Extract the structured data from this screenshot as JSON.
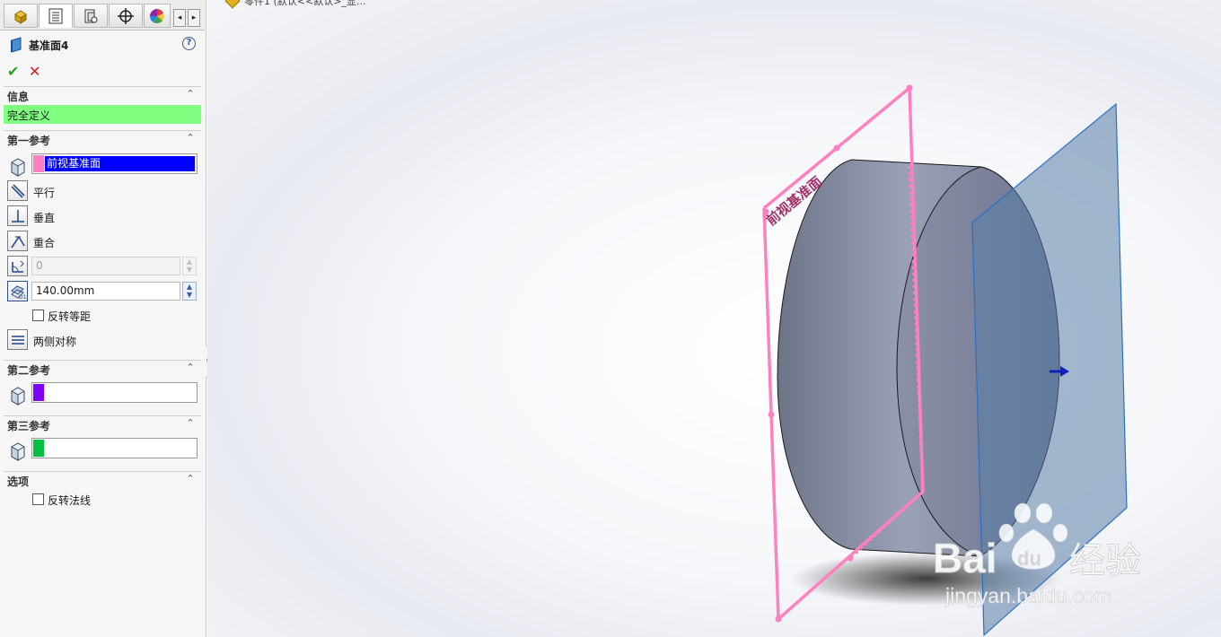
{
  "feature": {
    "title": "基准面4",
    "help": "?",
    "ok": "✔",
    "cancel": "✕"
  },
  "tabs": [
    {
      "name": "featuremanager",
      "icon": "part-feature-icon"
    },
    {
      "name": "propertymanager",
      "icon": "property-list-icon",
      "active": true
    },
    {
      "name": "configurationmanager",
      "icon": "config-icon"
    },
    {
      "name": "dimxpert",
      "icon": "crosshair-icon"
    },
    {
      "name": "display",
      "icon": "color-wheel-icon"
    }
  ],
  "tab_scroll": {
    "left": "◂",
    "right": "▸"
  },
  "info": {
    "header": "信息",
    "status": "完全定义"
  },
  "first_ref": {
    "header": "第一参考",
    "selection": "前视基准面",
    "swatch_color": "#ff80c0",
    "options": {
      "parallel": "平行",
      "perpendicular": "垂直",
      "coincident": "重合"
    },
    "angle_value": "0",
    "distance_value": "140.00mm",
    "flip_offset": "反转等距",
    "mid_plane": "两侧对称"
  },
  "second_ref": {
    "header": "第二参考",
    "selection": "",
    "swatch_color": "#8000ff"
  },
  "third_ref": {
    "header": "第三参考",
    "selection": "",
    "swatch_color": "#00c040"
  },
  "options": {
    "header": "选项",
    "flip_normal": "反转法线"
  },
  "collapse_glyph": "⌃",
  "viewport": {
    "breadcrumb": "零件1 (默认<<默认>_显...",
    "plane_label": "前视基准面",
    "preview_color": "#ff80c0",
    "new_plane_color": "#7f9bbd"
  },
  "watermark": {
    "brand": "Bai",
    "brand_suffix": "du",
    "cn": "经验",
    "url": "jingyan.baidu.com"
  }
}
